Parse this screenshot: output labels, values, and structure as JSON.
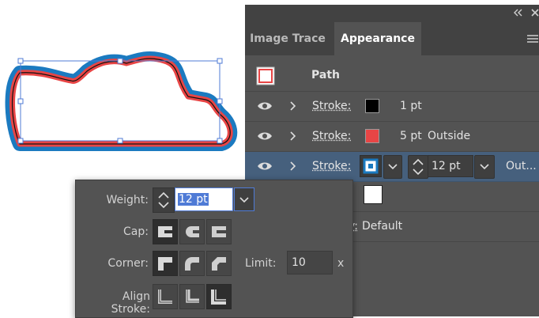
{
  "tabs": [
    {
      "label": "Image Trace",
      "active": false
    },
    {
      "label": "Appearance",
      "active": true
    }
  ],
  "panel_icons": {
    "collapse": "double-chevron-left-icon",
    "close": "close-icon",
    "menu": "hamburger-menu-icon"
  },
  "header": {
    "label": "Path"
  },
  "rows": [
    {
      "label": "Stroke:",
      "swatch": "#000000",
      "weight": "1 pt",
      "align": ""
    },
    {
      "label": "Stroke:",
      "swatch": "#e84545",
      "weight": "5 pt",
      "align": "Outside"
    },
    {
      "label": "Stroke:",
      "swatch": "#1b7ac0",
      "weight": "12 pt",
      "align": "Out..."
    }
  ],
  "opacity_row": {
    "label_partial": "y:",
    "value": "Default"
  },
  "stroke_options": {
    "weight_label": "Weight:",
    "weight_value": "12 pt",
    "cap_label": "Cap:",
    "corner_label": "Corner:",
    "limit_label": "Limit:",
    "limit_value": "10",
    "limit_unit": "x",
    "align_label": "Align Stroke:",
    "cap_selected": 0,
    "corner_selected": 0,
    "align_selected": 2
  },
  "colors": {
    "red": "#e84545",
    "blue": "#1b7ac0",
    "selection_blue": "#4f7bd6"
  }
}
